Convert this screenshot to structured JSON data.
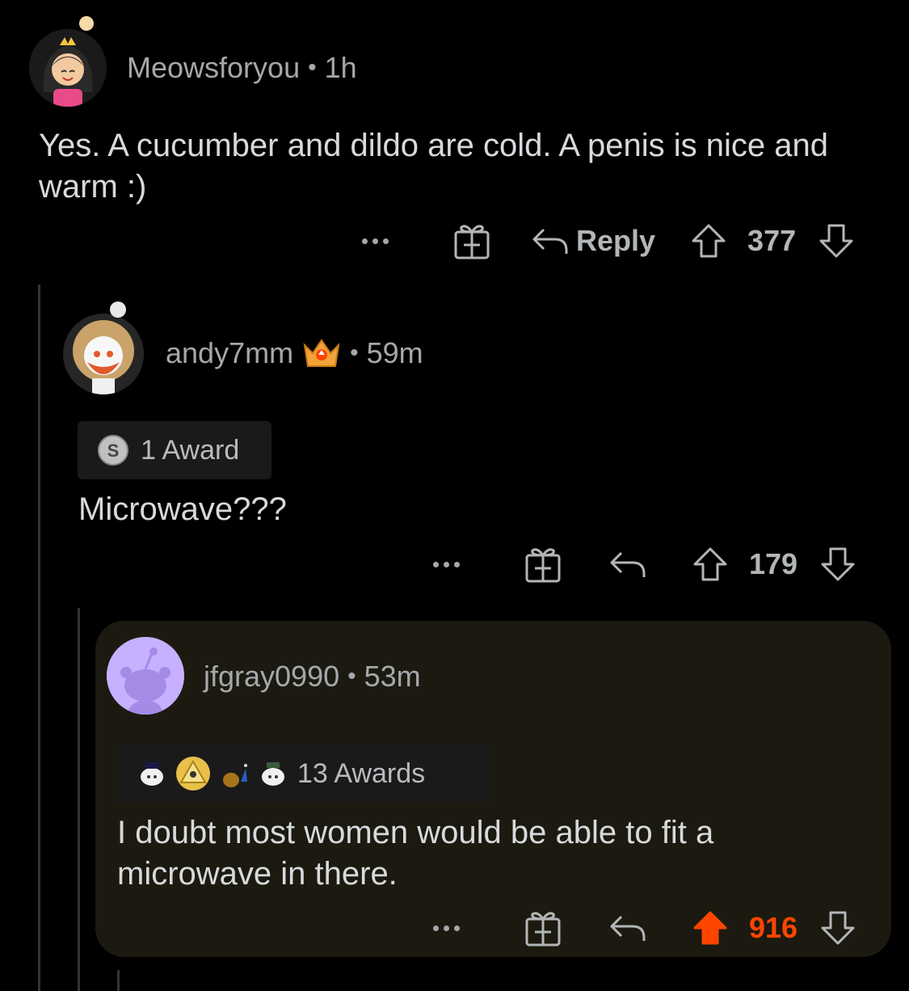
{
  "comments": [
    {
      "username": "Meowsforyou",
      "age": "1h",
      "text": "Yes. A cucumber and dildo are cold. A penis is nice and warm :)",
      "reply_label": "Reply",
      "score": "377",
      "avatar_icon": "avatar-girl-crown-icon"
    },
    {
      "username": "andy7mm",
      "age": "59m",
      "awards_label": "1 Award",
      "text": "Microwave???",
      "score": "179",
      "avatar_icon": "avatar-curly-hair-icon",
      "flair_icon": "crown-flair-icon"
    },
    {
      "username": "jfgray0990",
      "age": "53m",
      "awards_label": "13 Awards",
      "text": "I doubt most women would be able to fit a microwave in there.",
      "score": "916",
      "avatar_icon": "avatar-default-snoo-icon",
      "upvoted": true
    }
  ],
  "colors": {
    "upvote_active": "#ff4500",
    "highlight_bg": "#1c1a10",
    "background": "#000000"
  }
}
